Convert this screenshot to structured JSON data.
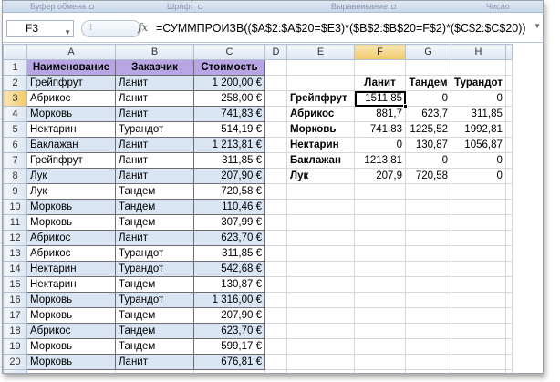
{
  "ribbon": {
    "groups": [
      {
        "label": "Буфер обмена"
      },
      {
        "label": "Шрифт"
      },
      {
        "label": "Выравнивание"
      },
      {
        "label": "Число"
      }
    ]
  },
  "formula_bar": {
    "name_box": "F3",
    "fx": "fx",
    "formula": "=СУММПРОИЗВ(($A$2:$A$20=$E3)*($B$2:$B$20=F$2)*($C$2:$C$20))"
  },
  "columns": [
    "A",
    "B",
    "C",
    "D",
    "E",
    "F",
    "G",
    "H"
  ],
  "rows": [
    "1",
    "2",
    "3",
    "4",
    "5",
    "6",
    "7",
    "8",
    "9",
    "10",
    "11",
    "12",
    "13",
    "14",
    "15",
    "16",
    "17",
    "18",
    "19",
    "20",
    "21"
  ],
  "table": {
    "headers": [
      "Наименование",
      "Заказчик",
      "Стоимость"
    ],
    "rows": [
      [
        "Грейпфрут",
        "Ланит",
        "1 200,00 €"
      ],
      [
        "Абрикос",
        "Ланит",
        "258,00 €"
      ],
      [
        "Морковь",
        "Ланит",
        "741,83 €"
      ],
      [
        "Нектарин",
        "Турандот",
        "514,19 €"
      ],
      [
        "Баклажан",
        "Ланит",
        "1 213,81 €"
      ],
      [
        "Грейпфрут",
        "Ланит",
        "311,85 €"
      ],
      [
        "Лук",
        "Ланит",
        "207,90 €"
      ],
      [
        "Лук",
        "Тандем",
        "720,58 €"
      ],
      [
        "Морковь",
        "Тандем",
        "110,46 €"
      ],
      [
        "Морковь",
        "Тандем",
        "307,99 €"
      ],
      [
        "Абрикос",
        "Ланит",
        "623,70 €"
      ],
      [
        "Абрикос",
        "Турандот",
        "311,85 €"
      ],
      [
        "Нектарин",
        "Турандот",
        "542,68 €"
      ],
      [
        "Нектарин",
        "Тандем",
        "130,87 €"
      ],
      [
        "Морковь",
        "Турандот",
        "1 316,00 €"
      ],
      [
        "Морковь",
        "Тандем",
        "207,90 €"
      ],
      [
        "Абрикос",
        "Тандем",
        "623,70 €"
      ],
      [
        "Морковь",
        "Тандем",
        "599,17 €"
      ],
      [
        "Морковь",
        "Ланит",
        "676,81 €"
      ]
    ]
  },
  "summary": {
    "customers": [
      "Ланит",
      "Тандем",
      "Турандот"
    ],
    "rows": [
      {
        "name": "Грейпфрут",
        "values": [
          "1511,85",
          "0",
          "0"
        ]
      },
      {
        "name": "Абрикос",
        "values": [
          "881,7",
          "623,7",
          "311,85"
        ]
      },
      {
        "name": "Морковь",
        "values": [
          "741,83",
          "1225,52",
          "1992,81"
        ]
      },
      {
        "name": "Нектарин",
        "values": [
          "0",
          "130,87",
          "1056,87"
        ]
      },
      {
        "name": "Баклажан",
        "values": [
          "1213,81",
          "0",
          "0"
        ]
      },
      {
        "name": "Лук",
        "values": [
          "207,9",
          "720,58",
          "0"
        ]
      }
    ]
  },
  "selection": {
    "cell": "F3"
  },
  "colors": {
    "header_fill": "#b7a6e3",
    "band_fill": "#d9e5f3",
    "selection": "#000000"
  }
}
